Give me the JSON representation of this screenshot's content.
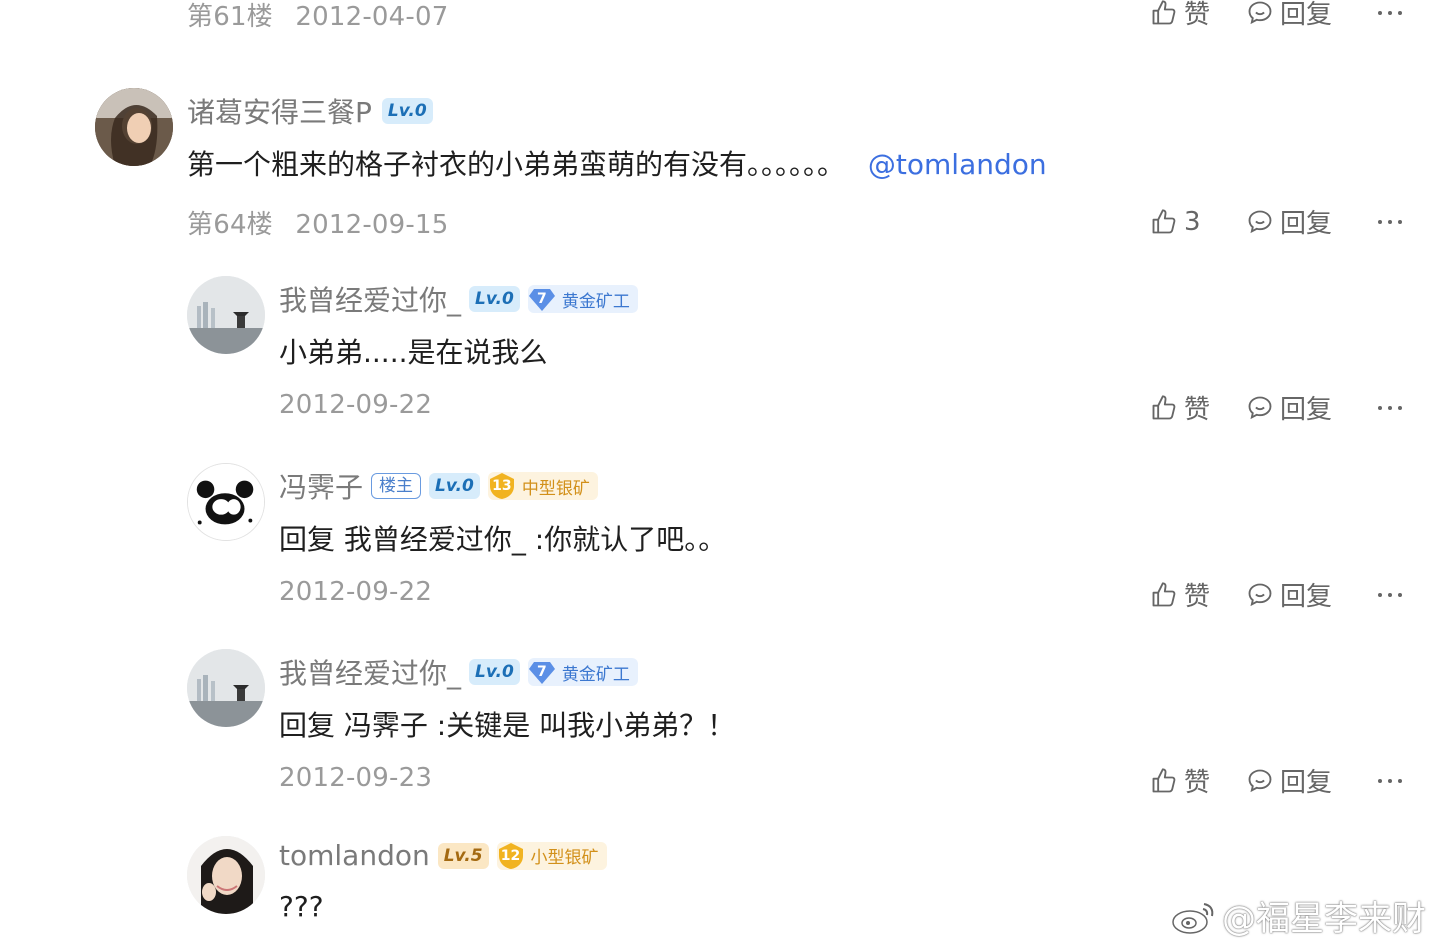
{
  "colors": {
    "link": "#3c6fe0",
    "meta": "#9a9a9a",
    "lv0_bg": "#d7ecfb",
    "gold_bg": "#e8f1fd",
    "silver_bg": "#fdf3df"
  },
  "top_row": {
    "floor": "第61楼",
    "date": "2012-04-07",
    "like": "赞",
    "reply": "回复"
  },
  "main_post": {
    "username": "诸葛安得三餐P",
    "level": "Lv.0",
    "text": "第一个粗来的格子衬衣的小弟弟蛮萌的有没有。。。。。。",
    "mention": "@tomlandon",
    "floor": "第64楼",
    "date": "2012-09-15",
    "like_count": "3",
    "reply": "回复"
  },
  "replies": [
    {
      "username": "我曾经爱过你_",
      "level": "Lv.0",
      "mine_num": "7",
      "mine_label": "黄金矿工",
      "text": "小弟弟.....是在说我么",
      "date": "2012-09-22",
      "like": "赞",
      "reply": "回复"
    },
    {
      "username": "冯霁子",
      "host": "楼主",
      "level": "Lv.0",
      "mine_num": "13",
      "mine_label": "中型银矿",
      "text": "回复 我曾经爱过你_ :你就认了吧。。",
      "date": "2012-09-22",
      "like": "赞",
      "reply": "回复"
    },
    {
      "username": "我曾经爱过你_",
      "level": "Lv.0",
      "mine_num": "7",
      "mine_label": "黄金矿工",
      "text": "回复 冯霁子 :关键是 叫我小弟弟？！",
      "date": "2012-09-23",
      "like": "赞",
      "reply": "回复"
    },
    {
      "username": "tomlandon",
      "level": "Lv.5",
      "mine_num": "12",
      "mine_label": "小型银矿",
      "text": "???"
    }
  ],
  "watermark": "@福星李来财",
  "icons": [
    "thumbs-up-icon",
    "comment-icon",
    "more-icon",
    "weibo-icon",
    "gem-icon"
  ]
}
